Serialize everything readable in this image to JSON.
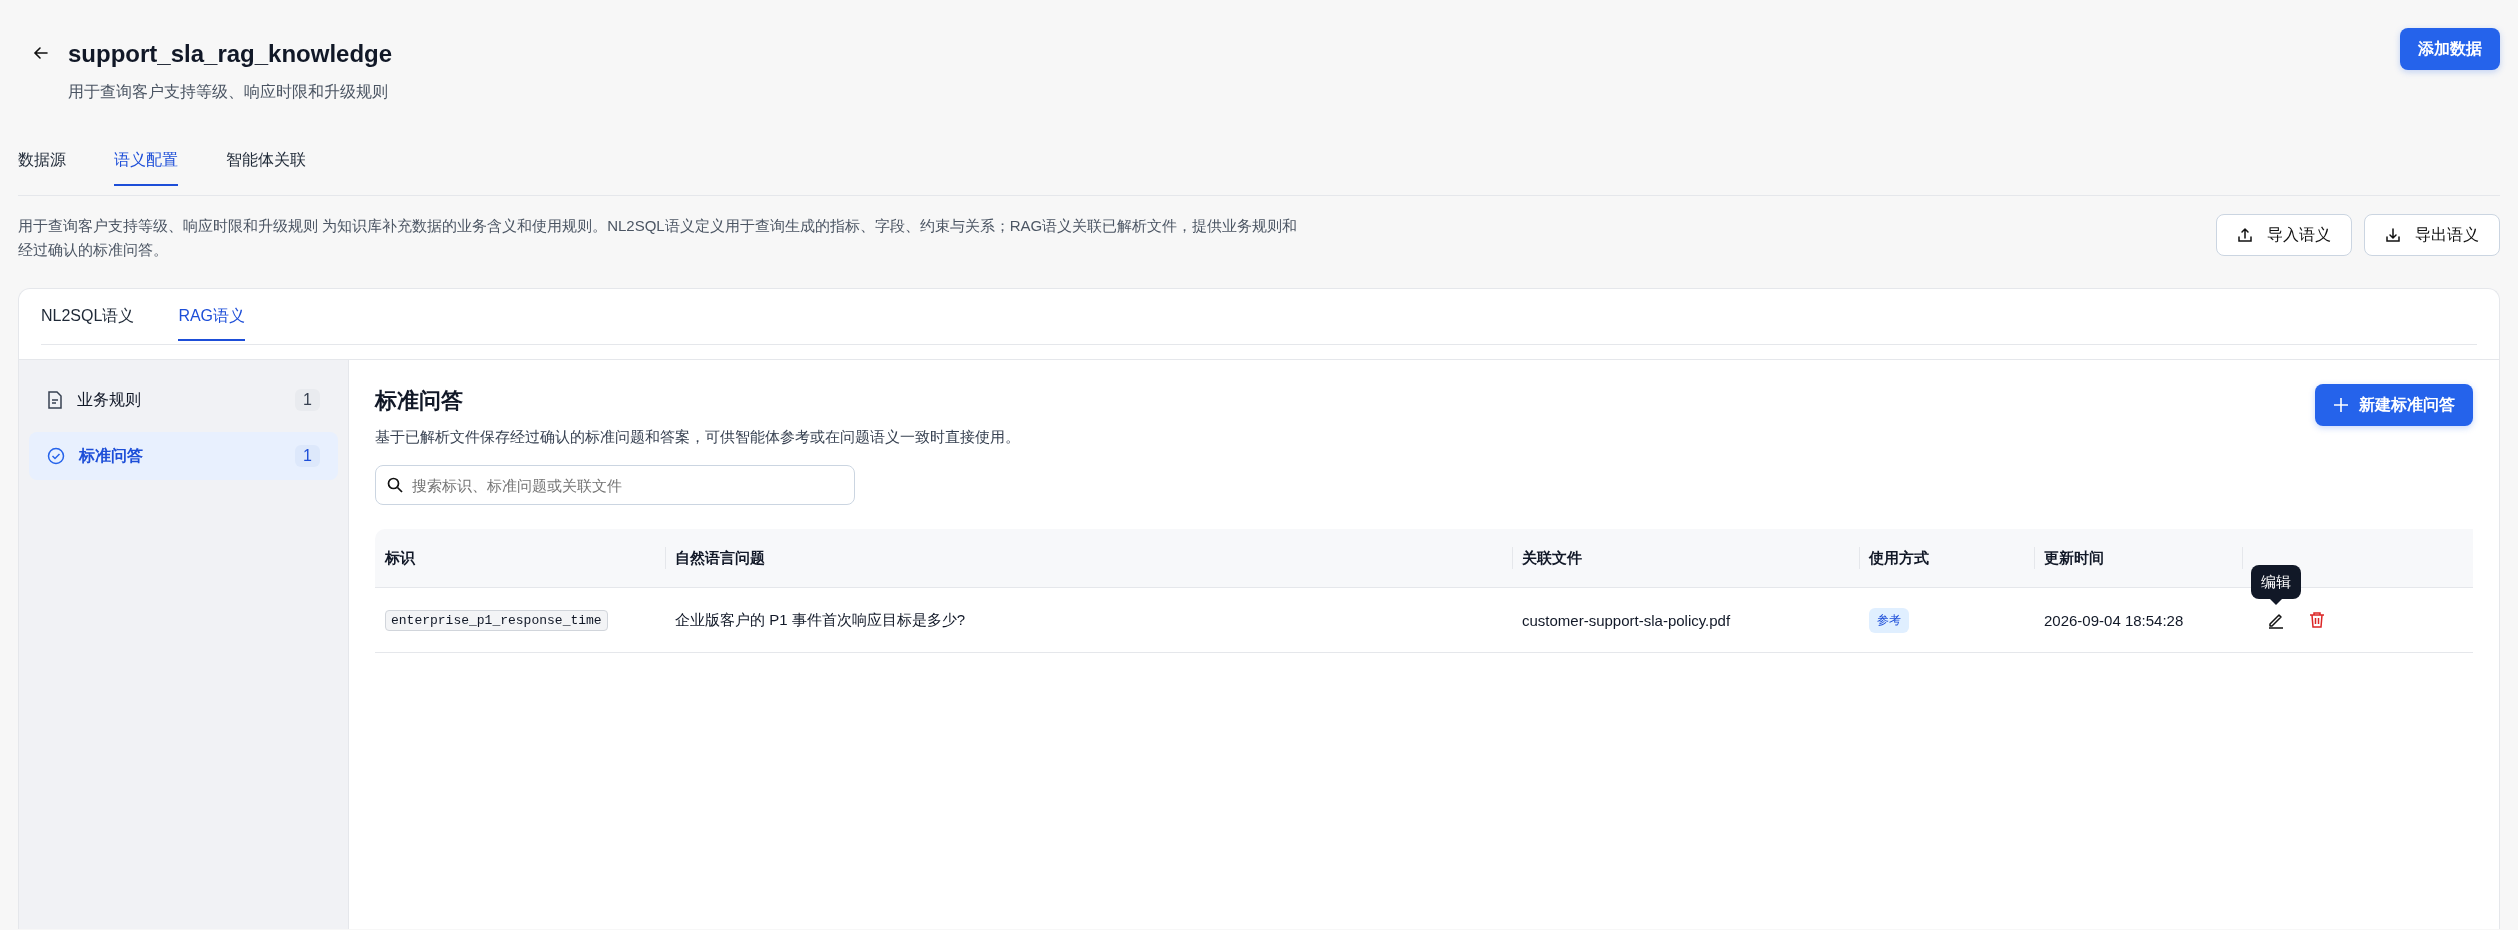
{
  "header": {
    "title": "support_sla_rag_knowledge",
    "subtitle": "用于查询客户支持等级、响应时限和升级规则",
    "primary_button": "添加数据"
  },
  "tabs": [
    {
      "label": "数据源",
      "selected": false
    },
    {
      "label": "语义配置",
      "selected": true
    },
    {
      "label": "智能体关联",
      "selected": false
    }
  ],
  "description": "用于查询客户支持等级、响应时限和升级规则 为知识库补充数据的业务含义和使用规则。NL2SQL语义定义用于查询生成的指标、字段、约束与关系；RAG语义关联已解析文件，提供业务规则和经过确认的标准问答。",
  "actions": [
    {
      "label": "导入语义",
      "kind": "upload"
    },
    {
      "label": "导出语义",
      "kind": "download"
    }
  ],
  "sub_tabs": [
    {
      "label": "NL2SQL语义",
      "selected": false
    },
    {
      "label": "RAG语义",
      "selected": true
    }
  ],
  "sidebar": {
    "items": [
      {
        "label": "业务规则",
        "count": "1",
        "kind": "document",
        "selected": false
      },
      {
        "label": "标准问答",
        "count": "1",
        "kind": "check",
        "selected": true
      }
    ]
  },
  "section": {
    "title": "标准问答",
    "description": "基于已解析文件保存经过确认的标准问题和答案，可供智能体参考或在问题语义一致时直接使用。",
    "new_button": "新建标准问答",
    "search": {
      "placeholder": "搜索标识、标准问题或关联文件"
    }
  },
  "table": {
    "columns": [
      "标识",
      "自然语言问题",
      "关联文件",
      "使用方式",
      "更新时间",
      ""
    ],
    "rows": [
      {
        "id": "enterprise_p1_response_time",
        "question": "企业版客户的 P1 事件首次响应目标是多少?",
        "file": "customer-support-sla-policy.pdf",
        "usage": "参考",
        "updated": "2026-09-04 18:54:28"
      }
    ]
  },
  "tooltip": "编辑"
}
